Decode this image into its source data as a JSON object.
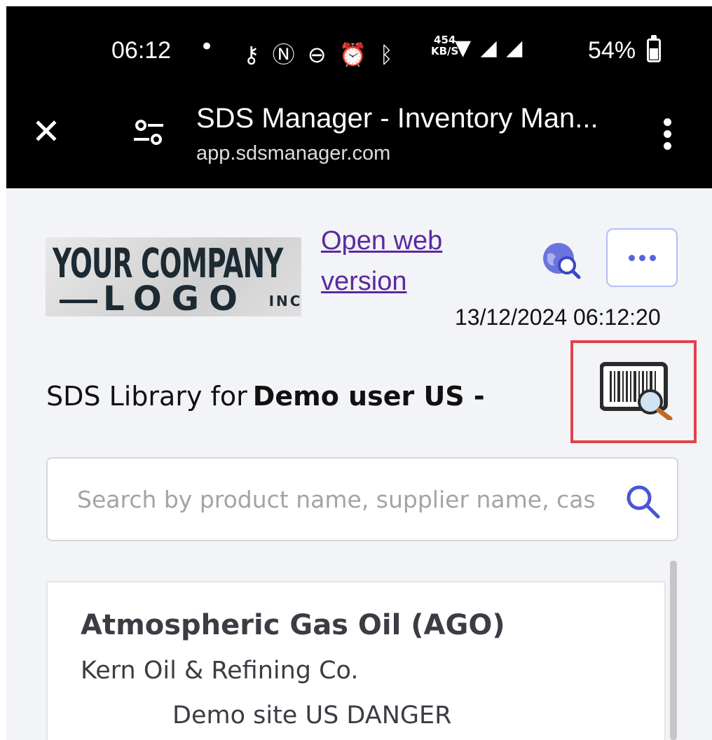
{
  "status_bar": {
    "time": "06:12",
    "separator": "•",
    "net_speed_value": "454",
    "net_speed_unit": "KB/S",
    "battery": "54%",
    "icons": [
      "key-icon",
      "nfc-icon",
      "do-not-disturb-icon",
      "alarm-icon",
      "bluetooth-icon",
      "wifi-icon",
      "signal-roaming-icon",
      "signal-roaming-icon",
      "battery-icon"
    ]
  },
  "browser_bar": {
    "title": "SDS Manager - Inventory Man...",
    "url": "app.sdsmanager.com",
    "icons": [
      "close-icon",
      "tune-icon",
      "more-vertical-icon"
    ]
  },
  "header": {
    "logo_line1": "YOUR COMPANY",
    "logo_line2": "LOGO",
    "logo_suffix": "INC.",
    "open_web_link": "Open web version",
    "timestamp": "13/12/2024 06:12:20",
    "icons": [
      "globe-search-icon",
      "more-horizontal-icon"
    ]
  },
  "library": {
    "label": "SDS Library for",
    "user": "Demo user US -",
    "barcode_icon": "barcode-scan-icon",
    "highlight_color": "#e0434b"
  },
  "search": {
    "placeholder": "Search by product name, supplier name, cas",
    "value": "",
    "icon": "search-icon"
  },
  "results": [
    {
      "product": "Atmospheric Gas Oil (AGO)",
      "supplier": "Kern Oil & Refining Co.",
      "site": "Demo site US DANGER"
    }
  ],
  "colors": {
    "accent": "#5b63d9",
    "link": "#5b2aa0",
    "background": "#f3f4f7"
  }
}
